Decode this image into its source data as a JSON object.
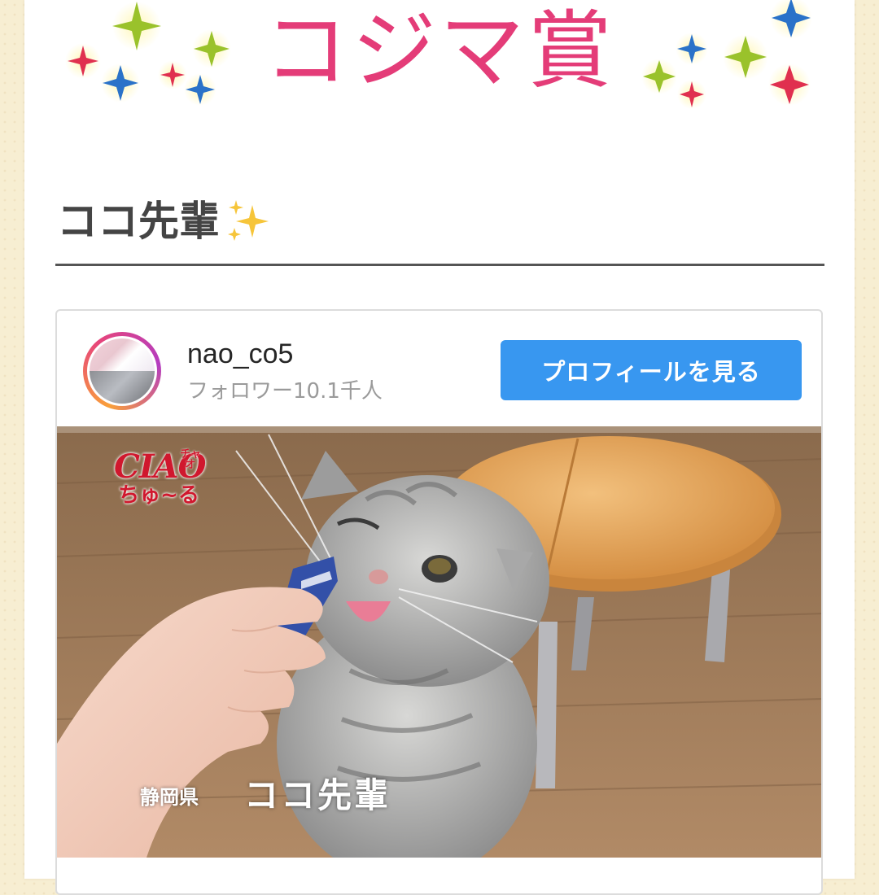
{
  "banner": {
    "title": "コジマ賞",
    "title_color": "#e43c78"
  },
  "section": {
    "heading": "ココ先輩"
  },
  "embed": {
    "username": "nao_co5",
    "followers": "フォロワー10.1千人",
    "profile_button_label": "プロフィールを見る",
    "button_color": "#3897f0",
    "photo": {
      "logo_brand": "CIAO",
      "logo_brand_kana": "チャオ",
      "logo_product": "ちゅ~る",
      "caption_prefecture": "静岡県",
      "caption_name": "ココ先輩"
    }
  }
}
